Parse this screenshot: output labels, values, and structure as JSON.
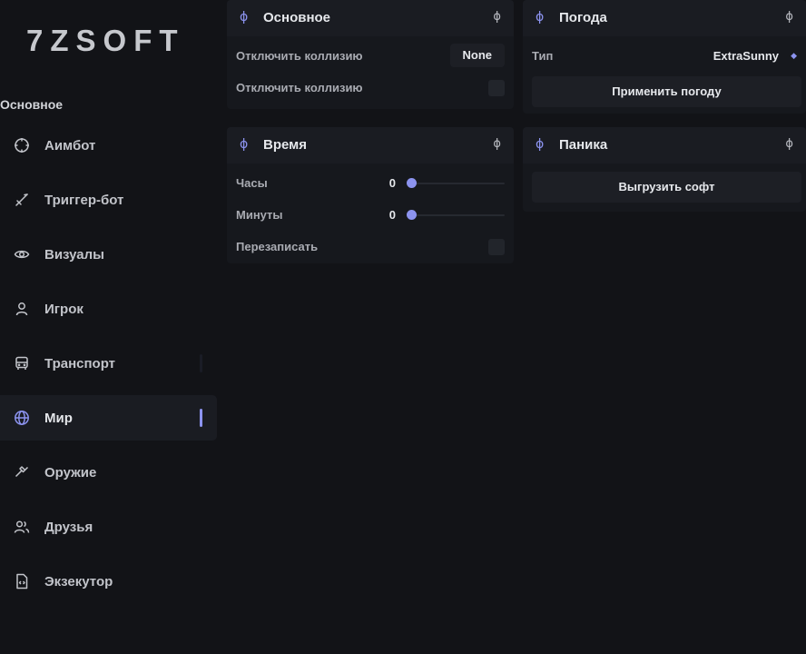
{
  "app": {
    "logo": "7ZSOFT"
  },
  "sidebar": {
    "section_label": "Основное",
    "items": [
      {
        "label": "Аимбот",
        "icon": "crosshair-icon"
      },
      {
        "label": "Триггер-бот",
        "icon": "sword-icon"
      },
      {
        "label": "Визуалы",
        "icon": "eye-icon"
      },
      {
        "label": "Игрок",
        "icon": "user-icon"
      },
      {
        "label": "Транспорт",
        "icon": "bus-icon"
      },
      {
        "label": "Мир",
        "icon": "globe-icon",
        "active": true
      },
      {
        "label": "Оружие",
        "icon": "hammer-icon"
      },
      {
        "label": "Друзья",
        "icon": "users-icon"
      },
      {
        "label": "Экзекутор",
        "icon": "file-code-icon"
      }
    ]
  },
  "panels": {
    "general": {
      "title": "Основное",
      "rows": [
        {
          "label": "Отключить коллизию",
          "value": "None"
        },
        {
          "label": "Отключить коллизию",
          "checked": false
        }
      ]
    },
    "weather": {
      "title": "Погода",
      "type_label": "Тип",
      "type_value": "ExtraSunny",
      "apply_button": "Применить погоду"
    },
    "time": {
      "title": "Время",
      "hours_label": "Часы",
      "hours_value": "0",
      "minutes_label": "Минуты",
      "minutes_value": "0",
      "override_label": "Перезаписать",
      "override_checked": false
    },
    "panic": {
      "title": "Паника",
      "unload_button": "Выгрузить софт"
    }
  },
  "symbols": {
    "phi": "ɸ"
  },
  "colors": {
    "accent": "#8c93ef",
    "background": "#121317",
    "panel": "#16181d",
    "panel_header": "#1a1c22"
  }
}
